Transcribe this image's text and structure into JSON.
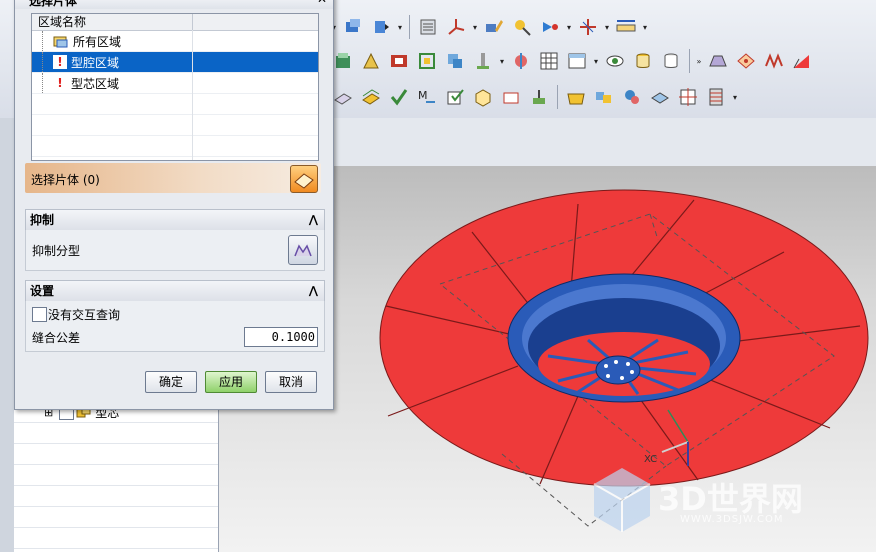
{
  "dialog": {
    "title": "选择片体",
    "table": {
      "column_header": "区域名称",
      "rows": [
        {
          "label": "所有区域",
          "icon": "folder-region-icon",
          "selected": false
        },
        {
          "label": "型腔区域",
          "icon": "exclamation-icon",
          "selected": true
        },
        {
          "label": "型芯区域",
          "icon": "exclamation-icon",
          "selected": false
        }
      ]
    },
    "select_sheet_label": "选择片体 (0)",
    "suppress_group": {
      "header": "抑制",
      "label": "抑制分型"
    },
    "settings_group": {
      "header": "设置",
      "checkbox_label": "没有交互查询",
      "checkbox_checked": false,
      "tolerance_label": "缝合公差",
      "tolerance_value": "0.1000"
    },
    "buttons": {
      "ok": "确定",
      "apply": "应用",
      "cancel": "取消"
    }
  },
  "navigator": {
    "rows": [
      {
        "expander": "⊞",
        "label": "型芯",
        "checked": false
      }
    ]
  },
  "viewport": {
    "axis_label": "XC",
    "watermark": "3D世界网",
    "watermark_url": "WWW.3DSJW.COM",
    "colors": {
      "cavity_surface": "#ee3a3a",
      "core_surface": "#2a5bb8",
      "background_top": "#bcbcbc",
      "background_bottom": "#f2f2f2"
    }
  },
  "toolbar": {
    "more_indicator": "»"
  }
}
